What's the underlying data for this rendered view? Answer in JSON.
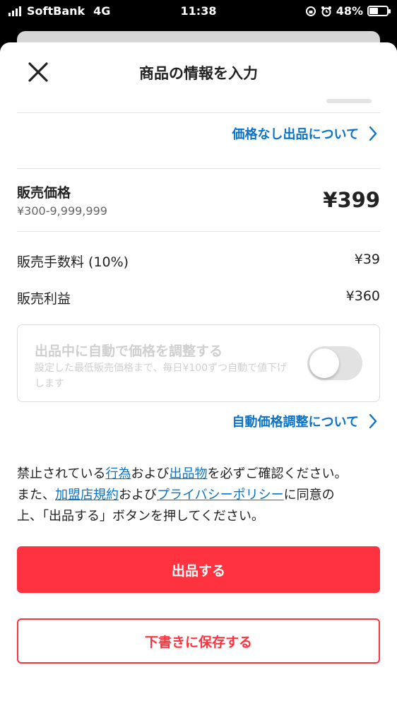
{
  "status_bar": {
    "carrier": "SoftBank",
    "network": "4G",
    "time": "11:38",
    "battery": "48%",
    "battery_level": 0.48
  },
  "header": {
    "title": "商品の情報を入力",
    "close_icon": "close-icon"
  },
  "price_free_link": {
    "label": "価格なし出品について"
  },
  "price": {
    "label": "販売価格",
    "range": "¥300-9,999,999",
    "value": "¥399"
  },
  "fee": {
    "label": "販売手数料 (10%)",
    "value": "¥39"
  },
  "profit": {
    "label": "販売利益",
    "value": "¥360"
  },
  "auto_adjust": {
    "title": "出品中に自動で価格を調整する",
    "description": "設定した最低販売価格まで、毎日¥100ずつ自動で値下げします",
    "enabled": false,
    "link": "自動価格調整について"
  },
  "notice": {
    "t1": "禁止されている",
    "l1": "行為",
    "t2": "および",
    "l2": "出品物",
    "t3": "を必ずご確認ください。",
    "t4": "また、",
    "l3": "加盟店規約",
    "t5": "および",
    "l4": "プライバシーポリシー",
    "t6": "に同意の",
    "t7": "上、「出品する」ボタンを押してください。"
  },
  "actions": {
    "submit": "出品する",
    "save_draft": "下書きに保存する"
  },
  "colors": {
    "accent_red": "#ff333f",
    "link_blue": "#0a73c9"
  }
}
